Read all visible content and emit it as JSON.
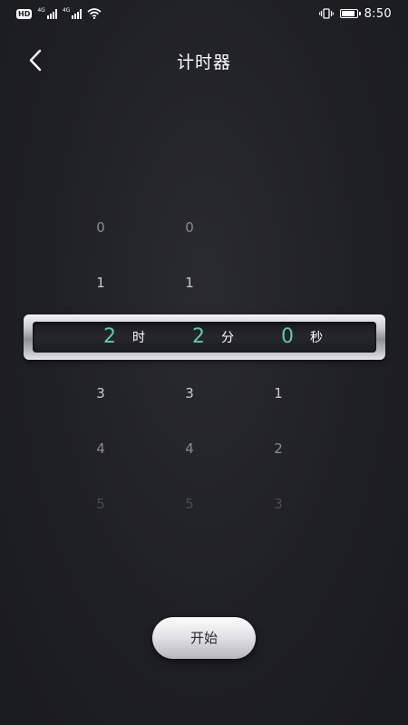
{
  "status_bar": {
    "hd_badge": "HD",
    "hd_sub": "2",
    "signal_1_tag": "4G",
    "signal_2_tag": "4G",
    "battery_level": 0.9,
    "time": "8:50"
  },
  "header": {
    "back_icon": "chevron-left-icon",
    "title": "计时器"
  },
  "picker": {
    "hours": {
      "rows": [
        "0",
        "1",
        "3",
        "4",
        "5"
      ],
      "selected": "2",
      "unit": "时"
    },
    "minutes": {
      "rows": [
        "0",
        "1",
        "3",
        "4",
        "5"
      ],
      "selected": "2",
      "unit": "分"
    },
    "seconds": {
      "rows": [
        "1",
        "2",
        "3"
      ],
      "selected": "0",
      "unit": "秒"
    },
    "accent_color": "#5ec8b3"
  },
  "start_button": {
    "label": "开始"
  }
}
